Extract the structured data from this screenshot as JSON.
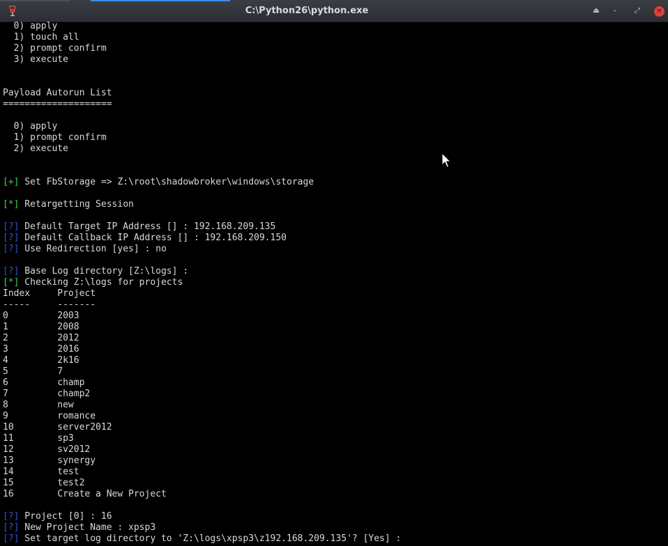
{
  "window": {
    "title": "C:\\Python26\\python.exe",
    "buttons": {
      "keep_above": "⏏",
      "minimize": "–",
      "maximize": "⤢",
      "close": "✕"
    },
    "colors": {
      "titlebar": "#2f3237",
      "close_button": "#e0413b",
      "tab_accent": "#3d8ee8"
    }
  },
  "console": {
    "colors": {
      "text": "#d9d9d9",
      "green_tag": "#3fd14b",
      "blue_tag": "#2f55c8",
      "background": "#000000"
    },
    "lines": [
      {
        "tag": "",
        "text": "  0) apply"
      },
      {
        "tag": "",
        "text": "  1) touch all"
      },
      {
        "tag": "",
        "text": "  2) prompt confirm"
      },
      {
        "tag": "",
        "text": "  3) execute"
      },
      {
        "tag": "",
        "text": ""
      },
      {
        "tag": "",
        "text": ""
      },
      {
        "tag": "",
        "text": "Payload Autorun List"
      },
      {
        "tag": "",
        "text": "===================="
      },
      {
        "tag": "",
        "text": ""
      },
      {
        "tag": "",
        "text": "  0) apply"
      },
      {
        "tag": "",
        "text": "  1) prompt confirm"
      },
      {
        "tag": "",
        "text": "  2) execute"
      },
      {
        "tag": "",
        "text": ""
      },
      {
        "tag": "",
        "text": ""
      },
      {
        "tag": "[+]",
        "text": " Set FbStorage => Z:\\root\\shadowbroker\\windows\\storage"
      },
      {
        "tag": "",
        "text": ""
      },
      {
        "tag": "[*]",
        "text": " Retargetting Session"
      },
      {
        "tag": "",
        "text": ""
      },
      {
        "tag": "[?]",
        "text": " Default Target IP Address [] : 192.168.209.135"
      },
      {
        "tag": "[?]",
        "text": " Default Callback IP Address [] : 192.168.209.150"
      },
      {
        "tag": "[?]",
        "text": " Use Redirection [yes] : no"
      },
      {
        "tag": "",
        "text": ""
      },
      {
        "tag": "[?]",
        "text": " Base Log directory [Z:\\logs] :"
      },
      {
        "tag": "[*]",
        "text": " Checking Z:\\logs for projects"
      },
      {
        "tag": "",
        "text": "Index     Project"
      },
      {
        "tag": "",
        "text": "-----     -------"
      },
      {
        "tag": "",
        "text": "0         2003"
      },
      {
        "tag": "",
        "text": "1         2008"
      },
      {
        "tag": "",
        "text": "2         2012"
      },
      {
        "tag": "",
        "text": "3         2016"
      },
      {
        "tag": "",
        "text": "4         2k16"
      },
      {
        "tag": "",
        "text": "5         7"
      },
      {
        "tag": "",
        "text": "6         champ"
      },
      {
        "tag": "",
        "text": "7         champ2"
      },
      {
        "tag": "",
        "text": "8         new"
      },
      {
        "tag": "",
        "text": "9         romance"
      },
      {
        "tag": "",
        "text": "10        server2012"
      },
      {
        "tag": "",
        "text": "11        sp3"
      },
      {
        "tag": "",
        "text": "12        sv2012"
      },
      {
        "tag": "",
        "text": "13        synergy"
      },
      {
        "tag": "",
        "text": "14        test"
      },
      {
        "tag": "",
        "text": "15        test2"
      },
      {
        "tag": "",
        "text": "16        Create a New Project"
      },
      {
        "tag": "",
        "text": ""
      },
      {
        "tag": "[?]",
        "text": " Project [0] : 16"
      },
      {
        "tag": "[?]",
        "text": " New Project Name : xpsp3"
      },
      {
        "tag": "[?]",
        "text": " Set target log directory to 'Z:\\logs\\xpsp3\\z192.168.209.135'? [Yes] :"
      }
    ]
  }
}
